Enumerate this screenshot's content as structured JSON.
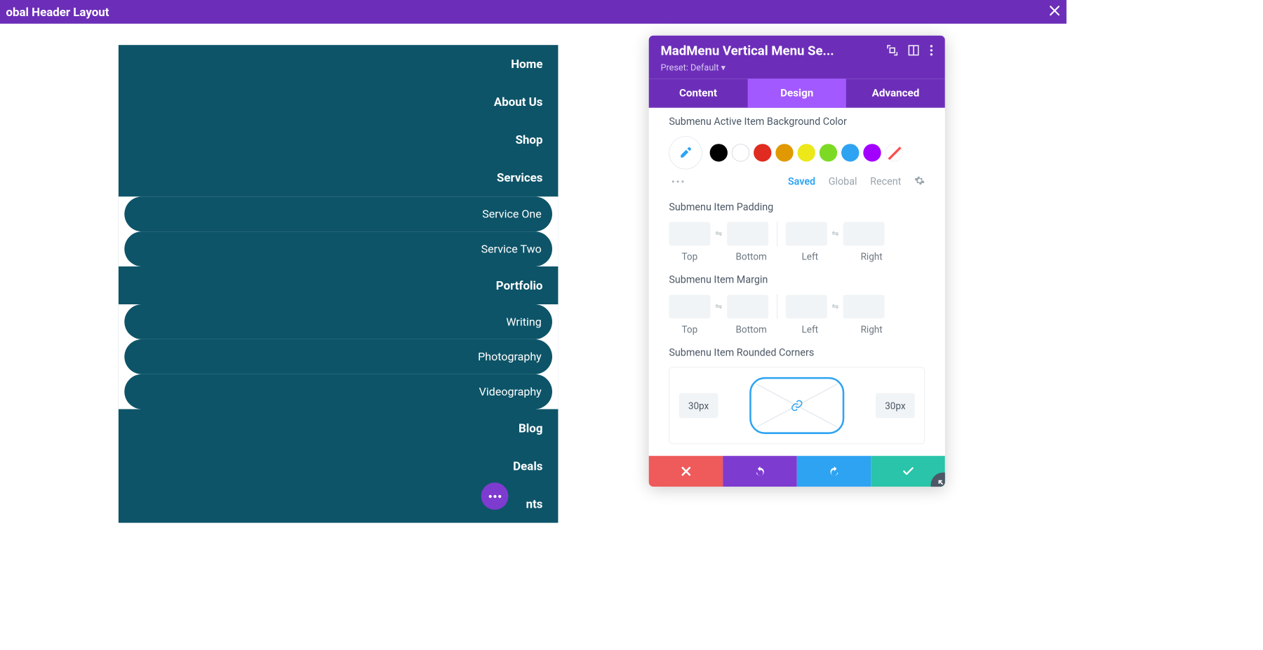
{
  "topbar": {
    "title": "obal Header Layout"
  },
  "menu": {
    "items": [
      "Home",
      "About Us",
      "Shop",
      "Services",
      "Portfolio",
      "Blog",
      "Deals",
      "nts"
    ],
    "services_sub": [
      "Service One",
      "Service Two"
    ],
    "portfolio_sub": [
      "Writing",
      "Photography",
      "Videography"
    ]
  },
  "panel": {
    "title": "MadMenu Vertical Menu Se...",
    "preset": "Preset: Default ▾",
    "tabs": {
      "content": "Content",
      "design": "Design",
      "advanced": "Advanced"
    },
    "color_label": "Submenu Active Item Background Color",
    "swatches": [
      "#000000",
      "#ffffff",
      "#e02b20",
      "#edb059",
      "#ece81a",
      "#7cda24",
      "#2ea3f2",
      "#a259ff"
    ],
    "preset_row": {
      "saved": "Saved",
      "global": "Global",
      "recent": "Recent"
    },
    "padding_label": "Submenu Item Padding",
    "margin_label": "Submenu Item Margin",
    "sides": {
      "top": "Top",
      "bottom": "Bottom",
      "left": "Left",
      "right": "Right"
    },
    "corners_label": "Submenu Item Rounded Corners",
    "corners": {
      "tl": "30px",
      "tr": "30px"
    }
  }
}
